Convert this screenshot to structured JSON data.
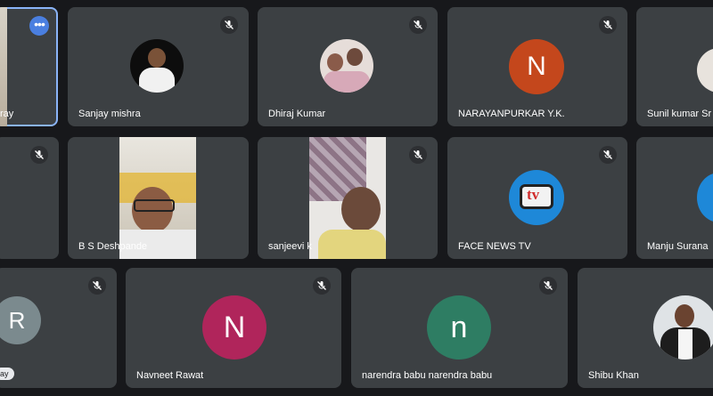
{
  "colors": {
    "tile_bg": "#3c4043",
    "page_bg": "#17181b",
    "active_outline": "#8ab4f8",
    "avatar_n_orange": "#c4471c",
    "avatar_n_pink": "#b0255b",
    "avatar_n_teal": "#2e7d63",
    "avatar_r_grey": "#7b8a8e"
  },
  "participants": {
    "p1": {
      "name": "ray",
      "menu_icon": "more-horiz-icon",
      "menu_label": "•••"
    },
    "p2": {
      "name": "Sanjay mishra"
    },
    "p3": {
      "name": "Dhiraj Kumar"
    },
    "p4": {
      "name": "NARAYANPURKAR Y.K.",
      "initial": "N"
    },
    "p5": {
      "name": "Sunil kumar Sr"
    },
    "p6": {
      "name": ""
    },
    "p7": {
      "name": "B S Deshpande"
    },
    "p8": {
      "name": "sanjeevi k"
    },
    "p9": {
      "name": "FACE NEWS TV",
      "logo_text": "tv"
    },
    "p10": {
      "name": "Manju Surana"
    },
    "p11": {
      "name": "",
      "initial": "R",
      "chip": "ay"
    },
    "p12": {
      "name": "Navneet Rawat",
      "initial": "N"
    },
    "p13": {
      "name": "narendra babu narendra babu",
      "initial": "n"
    },
    "p14": {
      "name": "Shibu Khan"
    }
  },
  "icons": {
    "mute": "mic-off-icon"
  }
}
